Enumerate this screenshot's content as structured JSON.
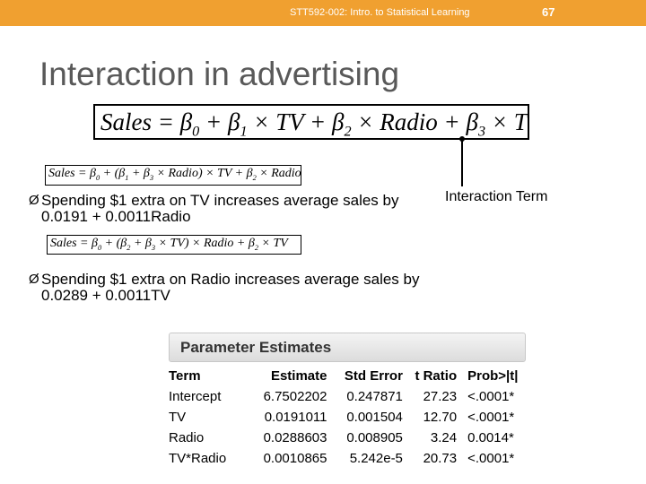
{
  "header": {
    "course": "STT592-002: Intro. to Statistical Learning",
    "page_number": "67",
    "accent_color": "#f0a030"
  },
  "slide": {
    "title": "Interaction in advertising"
  },
  "interaction_label": "Interaction Term",
  "bullets": [
    {
      "marker": "Ø",
      "text": "Spending $1 extra on TV increases average sales by 0.0191 + 0.0011Radio"
    },
    {
      "marker": "Ø",
      "text": "Spending $1 extra on Radio increases average sales by 0.0289 + 0.0011TV"
    }
  ],
  "parameter_estimates": {
    "title": "Parameter Estimates",
    "columns": [
      "Term",
      "Estimate",
      "Std Error",
      "t Ratio",
      "Prob>|t|"
    ],
    "rows": [
      [
        "Intercept",
        "6.7502202",
        "0.247871",
        "27.23",
        "<.0001*"
      ],
      [
        "TV",
        "0.0191011",
        "0.001504",
        "12.70",
        "<.0001*"
      ],
      [
        "Radio",
        "0.0288603",
        "0.008905",
        "3.24",
        "0.0014*"
      ],
      [
        "TV*Radio",
        "0.0010865",
        "5.242e-5",
        "20.73",
        "<.0001*"
      ]
    ]
  }
}
